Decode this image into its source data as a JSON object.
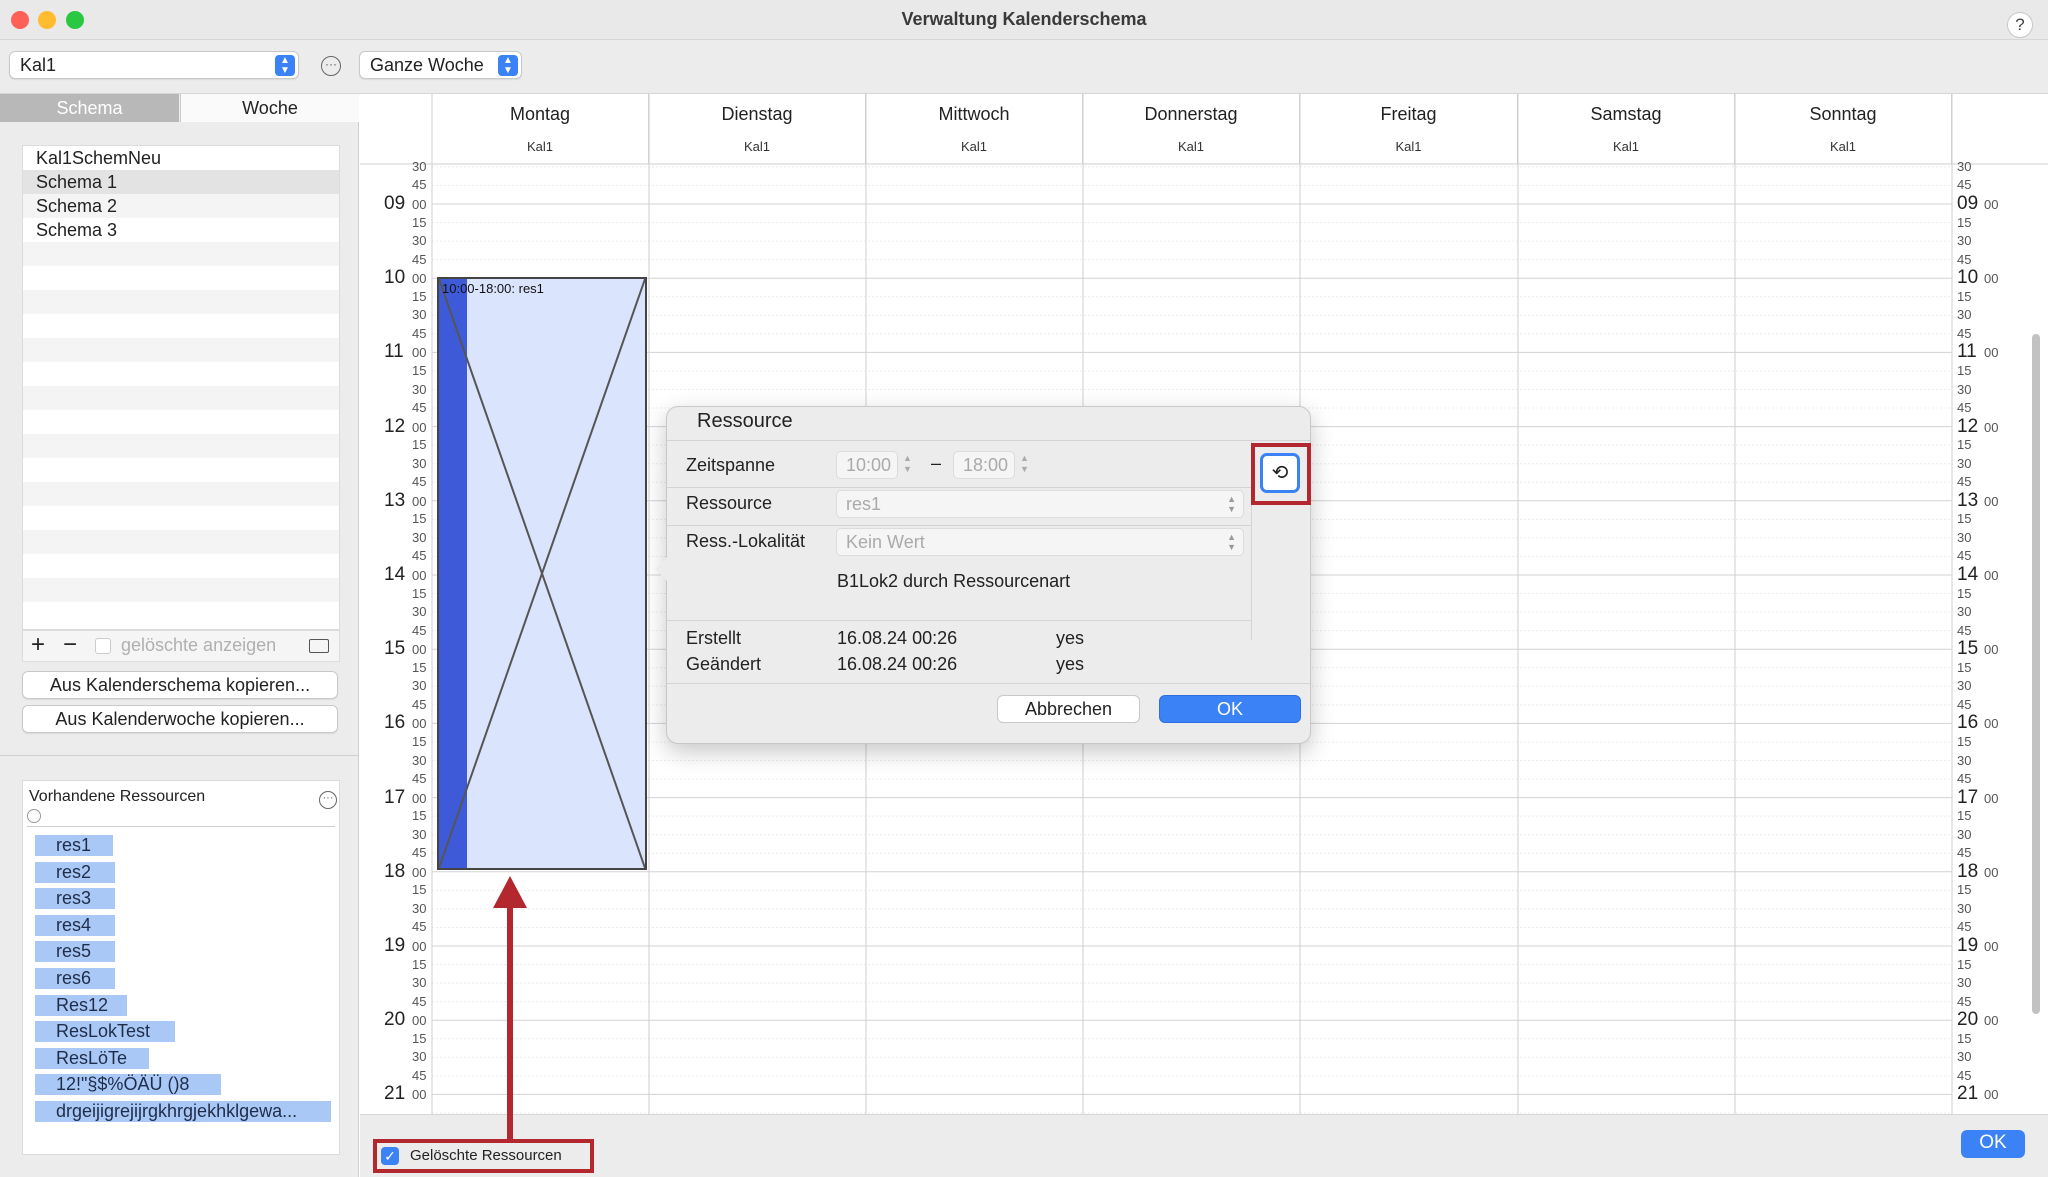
{
  "window": {
    "title": "Verwaltung Kalenderschema",
    "help": "?"
  },
  "toolbar": {
    "calendar_value": "Kal1",
    "range_value": "Ganze Woche"
  },
  "sidebar": {
    "tabs": [
      "Schema",
      "Woche"
    ],
    "schemas": [
      "Kal1SchemNeu",
      "Schema 1",
      "Schema 2",
      "Schema 3"
    ],
    "add_label": "+",
    "remove_label": "−",
    "show_deleted_label": "gelöschte anzeigen",
    "copy_schema_button": "Aus Kalenderschema kopieren...",
    "copy_week_button": "Aus Kalenderwoche kopieren...",
    "resources_title": "Vorhandene Ressourcen",
    "resources": [
      "res1",
      "res2",
      "res3",
      "res4",
      "res5",
      "res6",
      "Res12",
      "ResLokTest",
      "ResLöTe",
      "12!\"§$%ÖÄÜ ()8",
      "drgeijigrejijrgkhrgjekhklgewa..."
    ]
  },
  "calendar": {
    "days": [
      {
        "name": "Montag",
        "sub": "Kal1"
      },
      {
        "name": "Dienstag",
        "sub": "Kal1"
      },
      {
        "name": "Mittwoch",
        "sub": "Kal1"
      },
      {
        "name": "Donnerstag",
        "sub": "Kal1"
      },
      {
        "name": "Freitag",
        "sub": "Kal1"
      },
      {
        "name": "Samstag",
        "sub": "Kal1"
      },
      {
        "name": "Sonntag",
        "sub": "Kal1"
      }
    ],
    "hours": [
      "09",
      "10",
      "11",
      "12",
      "13",
      "14",
      "15",
      "16",
      "17",
      "18",
      "19",
      "20",
      "21"
    ],
    "minutes": [
      "00",
      "15",
      "30",
      "45"
    ],
    "event": {
      "label": "10:00-18:00: res1",
      "start": "10:00",
      "end": "18:00",
      "day": "Montag",
      "deleted": true
    }
  },
  "dialog": {
    "title": "Ressource",
    "zeitspanne_label": "Zeitspanne",
    "time_from": "10:00",
    "dash": "–",
    "time_to": "18:00",
    "ressource_label": "Ressource",
    "ressource_value": "res1",
    "lokalitaet_label": "Ress.-Lokalität",
    "lokalitaet_value": "Kein Wert",
    "note": "B1Lok2 durch Ressourcenart",
    "created_label": "Erstellt",
    "created_date": "16.08.24 00:26",
    "created_by": "yes",
    "changed_label": "Geändert",
    "changed_date": "16.08.24 00:26",
    "changed_by": "yes",
    "cancel_button": "Abbrechen",
    "ok_button": "OK"
  },
  "bottom": {
    "deleted_resources_label": "Gelöschte Ressourcen",
    "deleted_resources_checked": true,
    "ok_button": "OK"
  },
  "colors": {
    "accent": "#3b82f6",
    "event_fill": "#dbe4fd",
    "event_bar": "#3f5ad8",
    "annotation": "#b2282e",
    "chip": "#a9c8f5"
  }
}
